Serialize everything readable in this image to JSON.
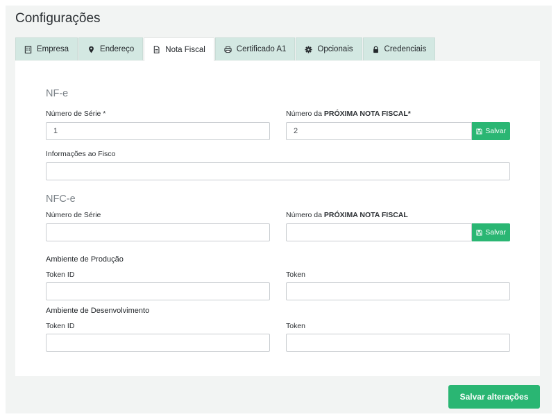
{
  "header": {
    "title": "Configurações"
  },
  "tabs": [
    {
      "label": "Empresa",
      "icon": "building-icon"
    },
    {
      "label": "Endereço",
      "icon": "map-pin-icon"
    },
    {
      "label": "Nota Fiscal",
      "icon": "document-icon"
    },
    {
      "label": "Certificado A1",
      "icon": "printer-icon"
    },
    {
      "label": "Opcionais",
      "icon": "gear-icon"
    },
    {
      "label": "Credenciais",
      "icon": "lock-icon"
    }
  ],
  "active_tab": "Nota Fiscal",
  "nfe": {
    "section_title": "NF-e",
    "serie_label": "Número de Série *",
    "serie_value": "1",
    "next_label_prefix": "Número da ",
    "next_label_bold": "PRÓXIMA NOTA FISCAL*",
    "next_value": "2",
    "save_label": "Salvar",
    "fisco_label": "Informações ao Fisco",
    "fisco_value": ""
  },
  "nfce": {
    "section_title": "NFC-e",
    "serie_label": "Número de Série",
    "serie_value": "",
    "next_label_prefix": "Número da ",
    "next_label_bold": "PRÓXIMA NOTA FISCAL",
    "next_value": "",
    "save_label": "Salvar",
    "producao": {
      "title": "Ambiente de Produção",
      "token_id_label": "Token ID",
      "token_label": "Token",
      "token_id_value": "",
      "token_value": ""
    },
    "desenvolvimento": {
      "title": "Ambiente de Desenvolvimento",
      "token_id_label": "Token ID",
      "token_label": "Token",
      "token_id_value": "",
      "token_value": ""
    }
  },
  "footer": {
    "save_changes_label": "Salvar alterações"
  },
  "colors": {
    "accent": "#2ab673",
    "tab_bg": "#d3e8e2",
    "page_bg": "#f2f4f3"
  }
}
